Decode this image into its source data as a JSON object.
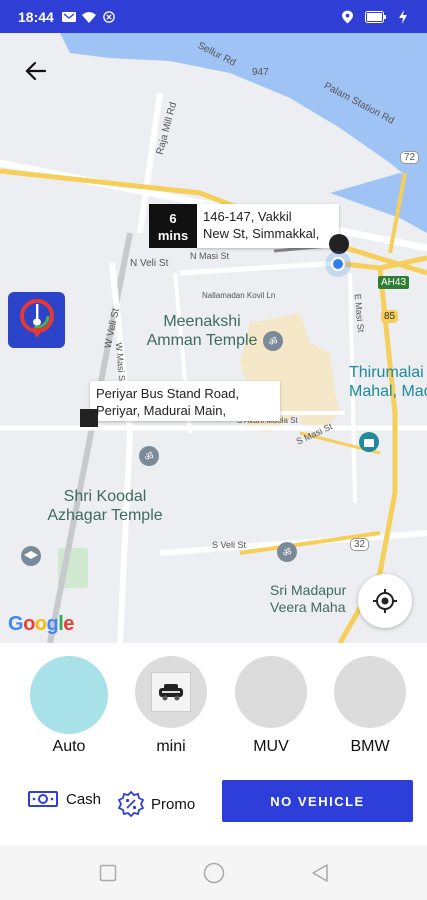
{
  "status_bar": {
    "time": "18:44",
    "icons": [
      "message-icon",
      "wifi-icon",
      "close-circle-icon",
      "location-icon",
      "battery-icon"
    ]
  },
  "map": {
    "pickup": {
      "eta_value": "6",
      "eta_unit": "mins",
      "address": "146-147, Vakkil\nNew St, Simmakkal,"
    },
    "drop": {
      "address": "Periyar Bus Stand Road,\nPeriyar, Madurai Main,"
    },
    "places": {
      "meenakshi": "Meenakshi\nAmman Temple",
      "koodal": "Shri Koodal\nAzhagar Temple",
      "thirumalai": "Thirumalai\nMahal, Mad",
      "madapuram": "Sri Madapur\nVeera Maha"
    },
    "streets": {
      "sellur": "Sellur Rd",
      "palam": "Palam Station Rd",
      "raja_mill": "Raja Mill Rd",
      "n_veli": "N Veli St",
      "w_veli": "W Veli St",
      "n_masi": "N Masi St",
      "w_masi": "W Masi St",
      "e_masi": "E Masi St",
      "nallamadan": "Nallamadan Kovil Ln",
      "s_avani": "S Avani Moola St",
      "s_masi": "S Masi St",
      "s_veli": "S Veli St"
    },
    "shields": {
      "r947": "947",
      "r72": "72",
      "ah43": "AH43",
      "r85": "85",
      "r32": "32"
    },
    "google_logo": "Google"
  },
  "vehicles": [
    {
      "name": "Auto",
      "selected": true
    },
    {
      "name": "mini",
      "selected": false
    },
    {
      "name": "MUV",
      "selected": false
    },
    {
      "name": "BMW",
      "selected": false
    }
  ],
  "actions": {
    "payment_label": "Cash",
    "promo_label": "Promo",
    "no_vehicle_button": "NO VEHICLE"
  },
  "colors": {
    "primary": "#2d3fd8",
    "auto_selected": "#a9e1e8",
    "water": "#9fc3f4",
    "road_yellow": "#f6cf5a"
  }
}
